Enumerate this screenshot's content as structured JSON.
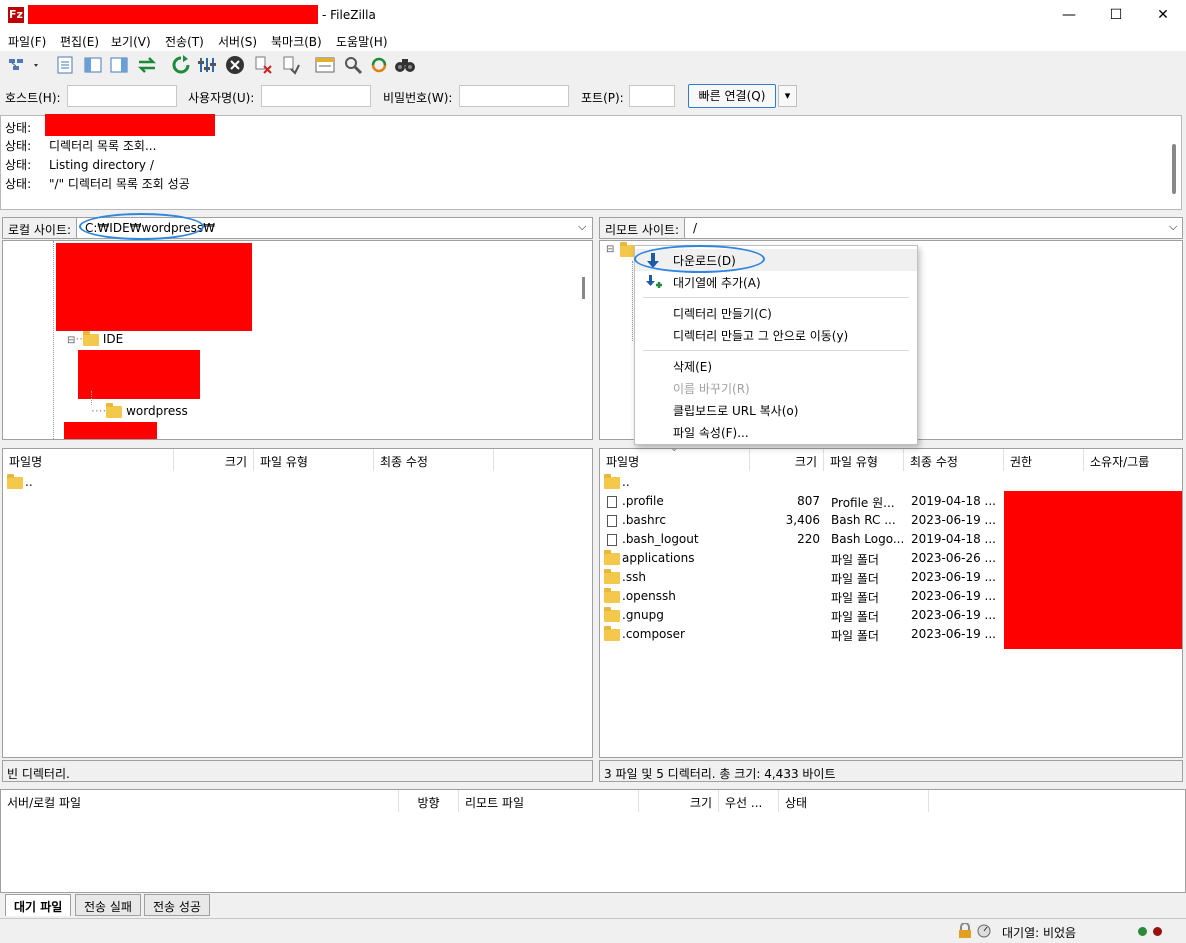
{
  "window": {
    "title_suffix": "- FileZilla",
    "app_icon_text": "Fz",
    "min": "—",
    "max": "☐",
    "close": "✕"
  },
  "menu": [
    "파일(F)",
    "편집(E)",
    "보기(V)",
    "전송(T)",
    "서버(S)",
    "북마크(B)",
    "도움말(H)"
  ],
  "quickconnect": {
    "host_label": "호스트(H):",
    "user_label": "사용자명(U):",
    "pass_label": "비밀번호(W):",
    "port_label": "포트(P):",
    "connect_button": "빠른 연결(Q)",
    "dropdown": "▾"
  },
  "log": {
    "label": "상태:",
    "lines": [
      "",
      "디렉터리 목록 조회...",
      "Listing directory /",
      "\"/\" 디렉터리 목록 조회 성공"
    ]
  },
  "local": {
    "site_label": "로컬 사이트:",
    "path": "C:₩IDE₩wordpress₩",
    "tree": {
      "ide": "IDE",
      "wordpress": "wordpress"
    },
    "columns": [
      "파일명",
      "크기",
      "파일 유형",
      "최종 수정"
    ],
    "files": [
      {
        "name": ".."
      }
    ],
    "status": "빈 디렉터리."
  },
  "remote": {
    "site_label": "리모트 사이트:",
    "path": "/",
    "columns": [
      "파일명",
      "크기",
      "파일 유형",
      "최종 수정",
      "권한",
      "소유자/그룹"
    ],
    "files": [
      {
        "name": "..",
        "size": "",
        "type": "",
        "modified": "",
        "kind": "folder"
      },
      {
        "name": ".profile",
        "size": "807",
        "type": "Profile 원...",
        "modified": "2019-04-18 ...",
        "kind": "file"
      },
      {
        "name": ".bashrc",
        "size": "3,406",
        "type": "Bash RC ...",
        "modified": "2023-06-19 ...",
        "kind": "file"
      },
      {
        "name": ".bash_logout",
        "size": "220",
        "type": "Bash Logo...",
        "modified": "2019-04-18 ...",
        "kind": "file"
      },
      {
        "name": "applications",
        "size": "",
        "type": "파일 폴더",
        "modified": "2023-06-26 ...",
        "kind": "folder"
      },
      {
        "name": ".ssh",
        "size": "",
        "type": "파일 폴더",
        "modified": "2023-06-19 ...",
        "kind": "folder"
      },
      {
        "name": ".openssh",
        "size": "",
        "type": "파일 폴더",
        "modified": "2023-06-19 ...",
        "kind": "folder"
      },
      {
        "name": ".gnupg",
        "size": "",
        "type": "파일 폴더",
        "modified": "2023-06-19 ...",
        "kind": "folder"
      },
      {
        "name": ".composer",
        "size": "",
        "type": "파일 폴더",
        "modified": "2023-06-19 ...",
        "kind": "folder"
      }
    ],
    "status": "3 파일 및 5 디렉터리. 총 크기: 4,433 바이트"
  },
  "context_menu": {
    "download": "다운로드(D)",
    "add_queue": "대기열에 추가(A)",
    "mkdir": "디렉터리 만들기(C)",
    "mkdir_enter": "디렉터리 만들고 그 안으로 이동(y)",
    "delete": "삭제(E)",
    "rename": "이름 바꾸기(R)",
    "copy_url": "클립보드로 URL 복사(o)",
    "properties": "파일 속성(F)..."
  },
  "queue": {
    "columns": [
      "서버/로컬 파일",
      "방향",
      "리모트 파일",
      "크기",
      "우선 ...",
      "상태"
    ],
    "tabs": [
      "대기 파일",
      "전송 실패",
      "전송 성공"
    ]
  },
  "statusbar": {
    "queue": "대기열: 비었음"
  },
  "colors": {
    "redaction": "#ff0000",
    "highlight": "#2e86de"
  }
}
